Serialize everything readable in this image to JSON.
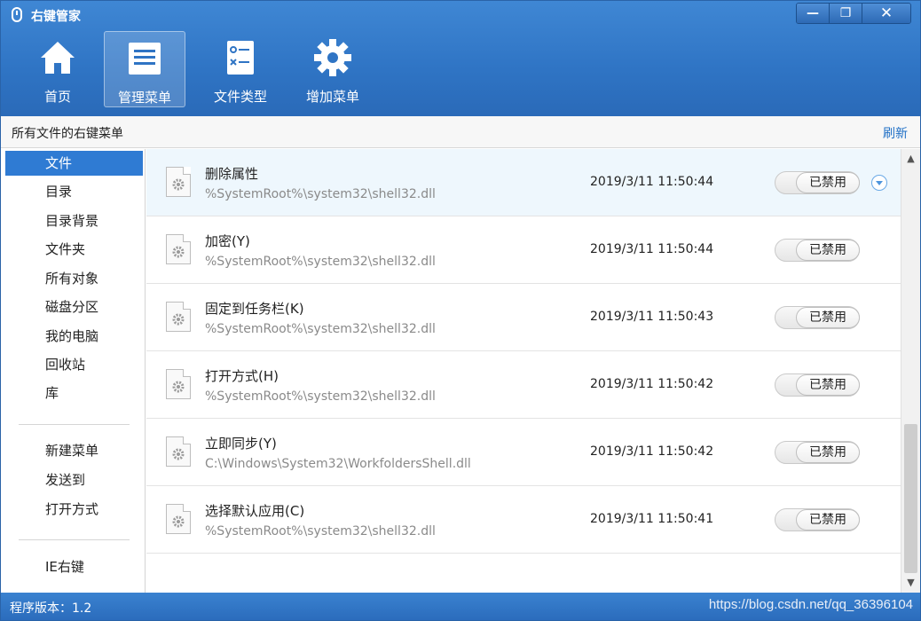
{
  "window": {
    "title": "右键管家",
    "controls": {
      "minimize": "—",
      "restore": "❐",
      "close": "✕"
    }
  },
  "toolbar": {
    "items": [
      {
        "label": "首页",
        "icon": "home-icon"
      },
      {
        "label": "管理菜单",
        "icon": "list-icon",
        "active": true
      },
      {
        "label": "文件类型",
        "icon": "file-type-icon"
      },
      {
        "label": "增加菜单",
        "icon": "gear-icon"
      }
    ]
  },
  "subheader": {
    "title": "所有文件的右键菜单",
    "refresh": "刷新"
  },
  "sidebar": {
    "group1": [
      "文件",
      "目录",
      "目录背景",
      "文件夹",
      "所有对象",
      "磁盘分区",
      "我的电脑",
      "回收站",
      "库"
    ],
    "group2": [
      "新建菜单",
      "发送到",
      "打开方式"
    ],
    "group3": [
      "IE右键"
    ],
    "active": "文件"
  },
  "rows": [
    {
      "name": "删除属性",
      "path": "%SystemRoot%\\system32\\shell32.dll",
      "date": "2019/3/11 11:50:44",
      "status": "已禁用"
    },
    {
      "name": "加密(Y)",
      "path": "%SystemRoot%\\system32\\shell32.dll",
      "date": "2019/3/11 11:50:44",
      "status": "已禁用"
    },
    {
      "name": "固定到任务栏(K)",
      "path": "%SystemRoot%\\system32\\shell32.dll",
      "date": "2019/3/11 11:50:43",
      "status": "已禁用"
    },
    {
      "name": "打开方式(H)",
      "path": "%SystemRoot%\\system32\\shell32.dll",
      "date": "2019/3/11 11:50:42",
      "status": "已禁用"
    },
    {
      "name": "立即同步(Y)",
      "path": "C:\\Windows\\System32\\WorkfoldersShell.dll",
      "date": "2019/3/11 11:50:42",
      "status": "已禁用"
    },
    {
      "name": "选择默认应用(C)",
      "path": "%SystemRoot%\\system32\\shell32.dll",
      "date": "2019/3/11 11:50:41",
      "status": "已禁用"
    }
  ],
  "statusbar": {
    "version": "程序版本：1.2",
    "watermark": "https://blog.csdn.net/qq_36396104"
  },
  "colors": {
    "header": "#2f74c4",
    "accent": "#2f7bd3",
    "link": "#1f6fc6",
    "row_highlight": "#eef7fd"
  }
}
